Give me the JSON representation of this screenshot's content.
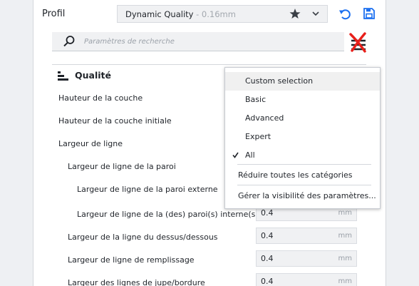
{
  "profile": {
    "label": "Profil",
    "name": "Dynamic Quality",
    "layer": " - 0.16mm"
  },
  "search": {
    "placeholder": "Paramètres de recherche"
  },
  "category": {
    "title": "Qualité"
  },
  "settings": [
    {
      "label": "Hauteur de la couche"
    },
    {
      "label": "Hauteur de la couche initiale"
    },
    {
      "label": "Largeur de ligne"
    },
    {
      "label": "Largeur de ligne de la paroi"
    },
    {
      "label": "Largeur de ligne de la paroi externe"
    },
    {
      "label": "Largeur de ligne de la (des) paroi(s) interne(s)",
      "value": "0.4",
      "unit": "mm"
    },
    {
      "label": "Largeur de la ligne du dessus/dessous",
      "value": "0.4",
      "unit": "mm"
    },
    {
      "label": "Largeur de ligne de remplissage",
      "value": "0.4",
      "unit": "mm"
    },
    {
      "label": "Largeur des lignes de jupe/bordure",
      "value": "0.4",
      "unit": "mm"
    }
  ],
  "visibility_menu": {
    "items": [
      {
        "label": "Custom selection",
        "highlighted": true
      },
      {
        "label": "Basic"
      },
      {
        "label": "Advanced"
      },
      {
        "label": "Expert"
      },
      {
        "label": "All",
        "checked": true
      }
    ],
    "collapse_all": "Réduire toutes les catégories",
    "manage_visibility": "Gérer la visibilité des paramètres..."
  },
  "colors": {
    "accent": "#196ef0",
    "filter_overlay": "#e8201b"
  },
  "icons": [
    "star-icon",
    "chevron-down-icon",
    "undo-icon",
    "save-icon",
    "search-icon",
    "filter-icon",
    "category-icon",
    "check-icon"
  ]
}
